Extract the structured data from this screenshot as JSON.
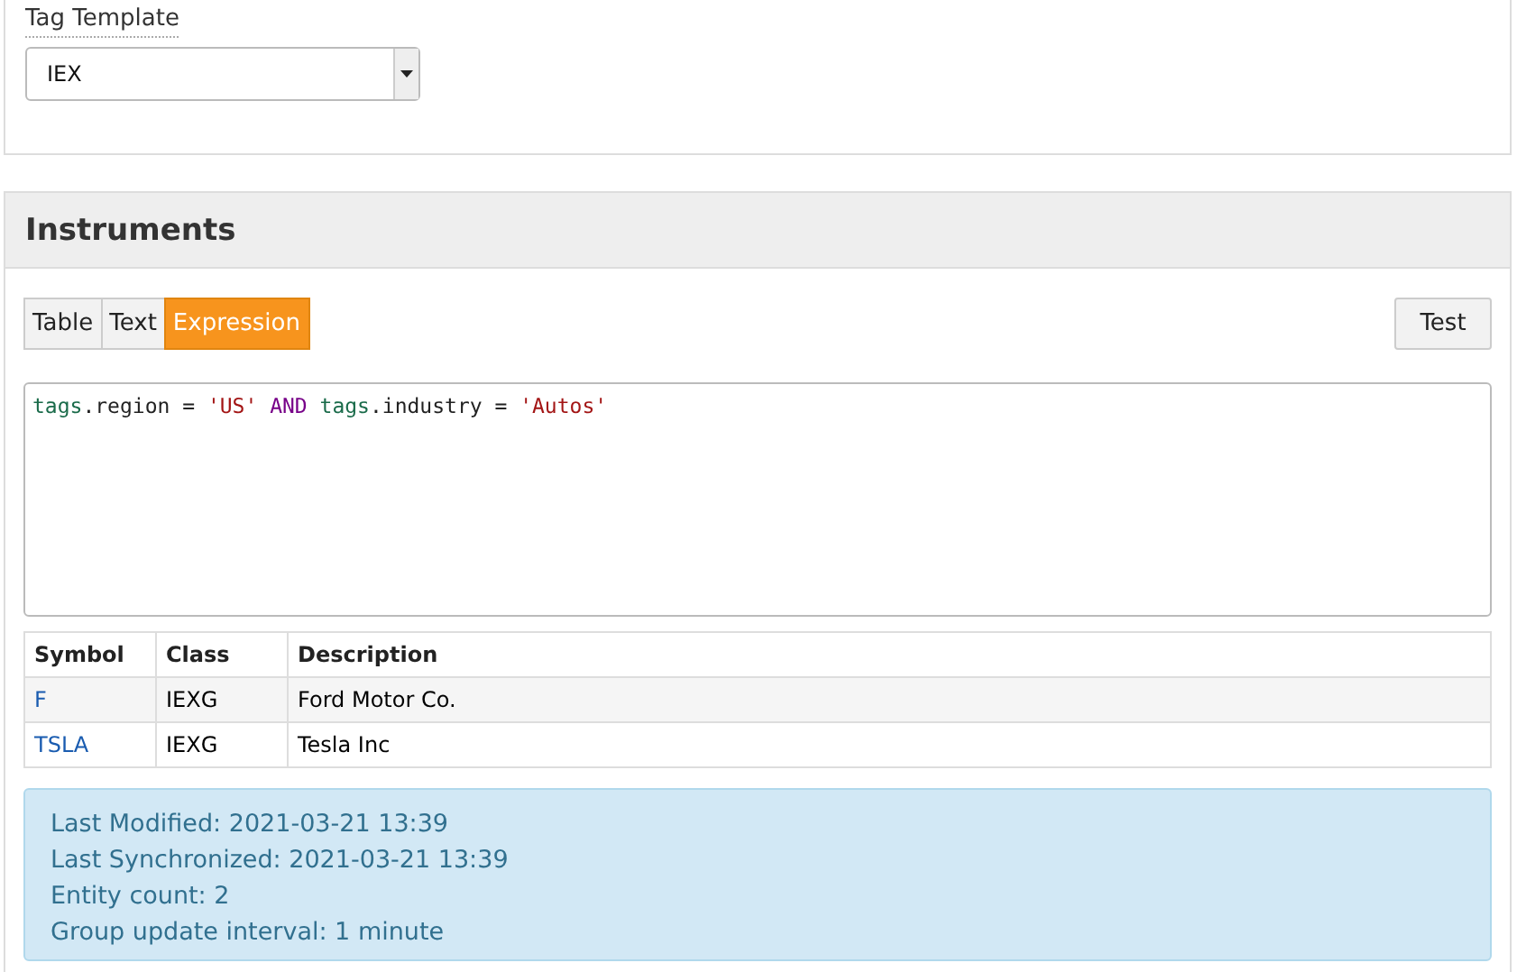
{
  "tag_template": {
    "label": "Tag Template",
    "value": "IEX"
  },
  "instruments": {
    "title": "Instruments",
    "tabs": [
      {
        "label": "Table",
        "selected": false
      },
      {
        "label": "Text",
        "selected": false
      },
      {
        "label": "Expression",
        "selected": true
      }
    ],
    "test_button": "Test",
    "expression": [
      {
        "kind": "ident",
        "text": "tags"
      },
      {
        "kind": "plain",
        "text": ".region = "
      },
      {
        "kind": "string",
        "text": "'US'"
      },
      {
        "kind": "keyword",
        "text": " AND "
      },
      {
        "kind": "ident",
        "text": "tags"
      },
      {
        "kind": "plain",
        "text": ".industry = "
      },
      {
        "kind": "string",
        "text": "'Autos'"
      }
    ],
    "table": {
      "columns": [
        "Symbol",
        "Class",
        "Description"
      ],
      "rows": [
        {
          "symbol": "F",
          "class": "IEXG",
          "description": "Ford Motor Co."
        },
        {
          "symbol": "TSLA",
          "class": "IEXG",
          "description": "Tesla Inc"
        }
      ]
    },
    "info": [
      "Last Modified: 2021-03-21 13:39",
      "Last Synchronized: 2021-03-21 13:39",
      "Entity count: 2",
      "Group update interval: 1 minute"
    ]
  }
}
